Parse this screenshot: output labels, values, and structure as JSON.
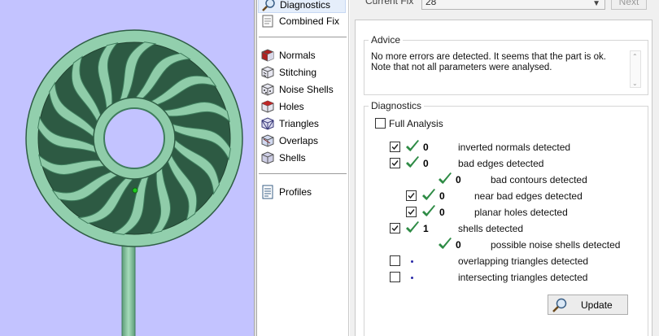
{
  "tools": {
    "diagnostics": {
      "label": "Diagnostics",
      "icon": "magnifier-icon"
    },
    "combined_fix": {
      "label": "Combined Fix",
      "icon": "document-icon"
    },
    "normals": {
      "label": "Normals",
      "icon": "cube-red-icon"
    },
    "stitching": {
      "label": "Stitching",
      "icon": "cube-stitch-icon"
    },
    "noise_shells": {
      "label": "Noise Shells",
      "icon": "cube-noise-icon"
    },
    "holes": {
      "label": "Holes",
      "icon": "cube-hole-icon"
    },
    "triangles": {
      "label": "Triangles",
      "icon": "cube-triangles-icon"
    },
    "overlaps": {
      "label": "Overlaps",
      "icon": "cube-overlaps-icon"
    },
    "shells": {
      "label": "Shells",
      "icon": "cube-shells-icon"
    },
    "profiles": {
      "label": "Profiles",
      "icon": "profile-doc-icon"
    }
  },
  "fix": {
    "label": "Current Fix",
    "value": "28",
    "next_label": "Next"
  },
  "advice": {
    "title": "Advice",
    "line1": "No more errors are detected. It seems that the part is ok.",
    "line2": "Note that not all parameters were analysed."
  },
  "diagnostics": {
    "title": "Diagnostics",
    "full_analysis_label": "Full Analysis",
    "full_analysis_checked": false,
    "rows": [
      {
        "checkbox": true,
        "checked": true,
        "status": "ok",
        "count": "0",
        "label": "inverted normals detected"
      },
      {
        "checkbox": true,
        "checked": true,
        "status": "ok",
        "count": "0",
        "label": "bad edges detected"
      },
      {
        "checkbox": false,
        "checked": false,
        "status": "ok",
        "count": "0",
        "label": "bad contours detected"
      },
      {
        "checkbox": true,
        "checked": true,
        "status": "ok",
        "count": "0",
        "label": "near bad edges detected"
      },
      {
        "checkbox": true,
        "checked": true,
        "status": "ok",
        "count": "0",
        "label": "planar holes detected"
      },
      {
        "checkbox": true,
        "checked": true,
        "status": "ok",
        "count": "1",
        "label": "shells detected"
      },
      {
        "checkbox": false,
        "checked": false,
        "status": "ok",
        "count": "0",
        "label": "possible noise shells detected"
      },
      {
        "checkbox": true,
        "checked": false,
        "status": "not-analysed",
        "count": "",
        "label": "overlapping triangles detected"
      },
      {
        "checkbox": true,
        "checked": false,
        "status": "not-analysed",
        "count": "",
        "label": "intersecting triangles detected"
      }
    ],
    "update_label": "Update"
  },
  "colors": {
    "viewport_bg": "#c3c3ff",
    "part_fill": "#8ec9a6",
    "part_dark": "#3f7d5d",
    "tick_green": "#2e8b45"
  }
}
